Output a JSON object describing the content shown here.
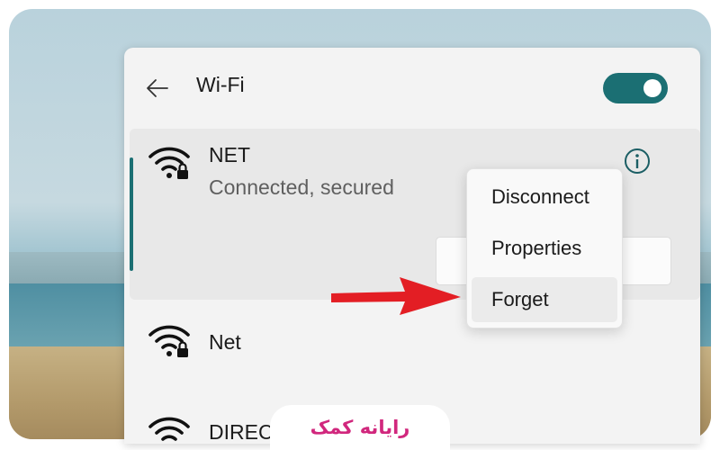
{
  "panel": {
    "title": "Wi-Fi",
    "wifi_enabled": true
  },
  "networks": [
    {
      "name": "NET",
      "status": "Connected, secured",
      "secured": true,
      "active": true
    },
    {
      "name": "Net",
      "secured": true
    },
    {
      "name": "DIRECT",
      "secured": true
    }
  ],
  "context_menu": {
    "items": [
      "Disconnect",
      "Properties",
      "Forget"
    ]
  },
  "watermark": "رایانه کمک",
  "colors": {
    "accent": "#1b6f73",
    "arrow": "#e31e24",
    "watermark": "#d1277d"
  },
  "icons": [
    "back-arrow-icon",
    "wifi-secured-icon",
    "info-icon",
    "red-arrow-pointer"
  ]
}
